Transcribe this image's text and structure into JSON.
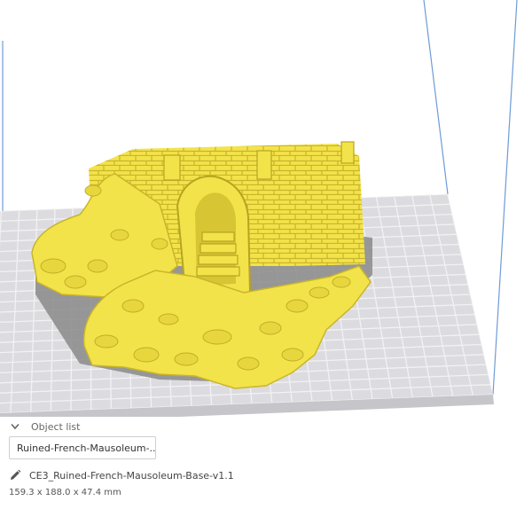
{
  "object_list": {
    "header": "Object list",
    "entry": "Ruined-French-Mausoleum-..."
  },
  "file": {
    "name": "CE3_Ruined-French-Mausoleum-Base-v1.1",
    "dimensions": "159.3 x 188.0 x 47.4 mm"
  },
  "icons": {
    "collapse": "chevron-down-icon",
    "edit": "pencil-icon"
  },
  "colors": {
    "model": "#f3e34a",
    "model_shade": "#c9b52a",
    "plate": "#dcdce0",
    "grid": "#f2f2f4",
    "build_volume_edge": "#6e9bd6",
    "shadow": "#8a8a8a"
  }
}
